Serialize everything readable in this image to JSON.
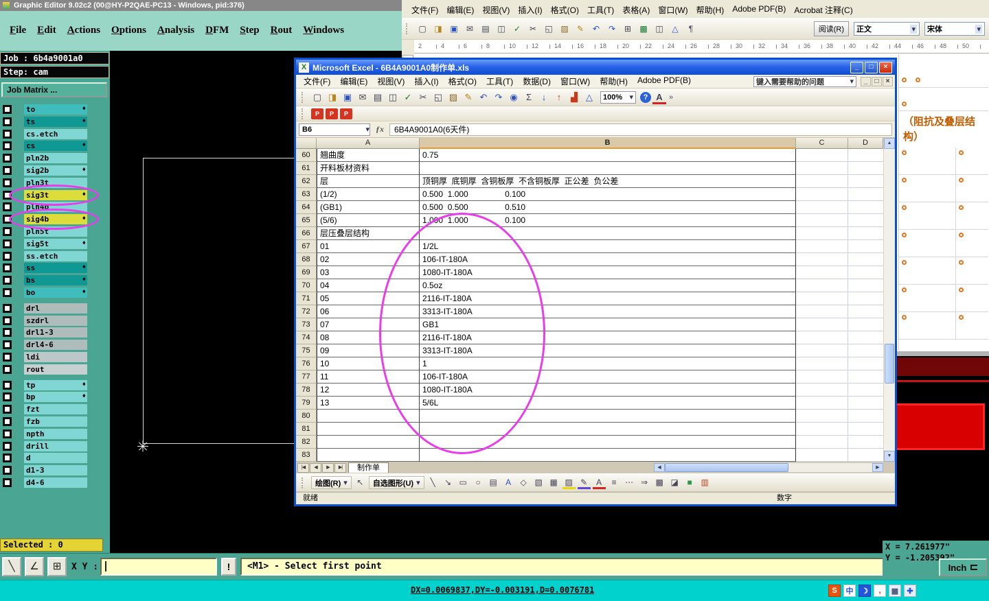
{
  "graphic_editor": {
    "title": "Graphic Editor 9.02c2 (00@HY-P2QAE-PC13 - Windows, pid:376)",
    "menus": [
      "File",
      "Edit",
      "Actions",
      "Options",
      "Analysis",
      "DFM",
      "Step",
      "Rout",
      "Windows"
    ],
    "job_label": "Job : 6b4a9001a0",
    "step_label": "Step: cam",
    "job_matrix_button": "Job Matrix ...",
    "selected_label": "Selected : 0",
    "xy_label": "X Y :",
    "xy_input_value": "",
    "alert_button": "!",
    "status_message": "<M1> - Select first point",
    "units_button": "Inch",
    "coord_x": "X = 7.261977\"",
    "coord_y": "Y = -1.205392\"",
    "accent_color": "#4aa592",
    "annotation_color": "#ea3cea",
    "toolbar_icons": [
      {
        "name": "measure-icon",
        "glyph": "╲"
      },
      {
        "name": "angle-icon",
        "glyph": "∠"
      },
      {
        "name": "grid-icon",
        "glyph": "⊞"
      }
    ],
    "layers": [
      {
        "name": "to",
        "color": "#3fbcbc",
        "marker": true
      },
      {
        "name": "ts",
        "color": "#0f9894",
        "marker": true
      },
      {
        "name": "cs.etch",
        "color": "#7fd6d2",
        "marker": false
      },
      {
        "name": "cs",
        "color": "#0f9894",
        "marker": true
      },
      {
        "name": "pln2b",
        "color": "#7fd6d2",
        "marker": false
      },
      {
        "name": "sig2b",
        "color": "#7fd6d2",
        "marker": true
      },
      {
        "name": "pln3t",
        "color": "#7fd6d2",
        "marker": false
      },
      {
        "name": "sig3t",
        "color": "#dcdc3a",
        "marker": true,
        "circled": true
      },
      {
        "name": "pln4b",
        "color": "#7fd6d2",
        "marker": false
      },
      {
        "name": "sig4b",
        "color": "#dcdc3a",
        "marker": true,
        "circled": true
      },
      {
        "name": "pln5t",
        "color": "#7fd6d2",
        "marker": false
      },
      {
        "name": "sig5t",
        "color": "#7fd6d2",
        "marker": true
      },
      {
        "name": "ss.etch",
        "color": "#7fd6d2",
        "marker": false
      },
      {
        "name": "ss",
        "color": "#0f9894",
        "marker": true
      },
      {
        "name": "bs",
        "color": "#0f9894",
        "marker": true
      },
      {
        "name": "bo",
        "color": "#3fbcbc",
        "marker": true
      },
      {
        "name": "drl",
        "color": "#aebcbc",
        "marker": false
      },
      {
        "name": "szdrl",
        "color": "#aebcbc",
        "marker": false
      },
      {
        "name": "drl1-3",
        "color": "#aebcbc",
        "marker": false
      },
      {
        "name": "drl4-6",
        "color": "#aebcbc",
        "marker": false
      },
      {
        "name": "ldi",
        "color": "#bcc8c8",
        "marker": false
      },
      {
        "name": "rout",
        "color": "#c6d0d0",
        "marker": false
      },
      {
        "name": "tp",
        "color": "#7fd6d2",
        "marker": true
      },
      {
        "name": "bp",
        "color": "#7fd6d2",
        "marker": true
      },
      {
        "name": "fzt",
        "color": "#7fd6d2",
        "marker": false
      },
      {
        "name": "fzb",
        "color": "#7fd6d2",
        "marker": false
      },
      {
        "name": "npth",
        "color": "#7fd6d2",
        "marker": false
      },
      {
        "name": "drill",
        "color": "#7fd6d2",
        "marker": false
      },
      {
        "name": "d",
        "color": "#7fd6d2",
        "marker": false
      },
      {
        "name": "d1-3",
        "color": "#7fd6d2",
        "marker": false
      },
      {
        "name": "d4-6",
        "color": "#7fd6d2",
        "marker": false
      }
    ]
  },
  "excel": {
    "title": "Microsoft Excel - 6B4A9001A0制作单.xls",
    "menus": [
      "文件(F)",
      "编辑(E)",
      "视图(V)",
      "插入(I)",
      "格式(O)",
      "工具(T)",
      "数据(D)",
      "窗口(W)",
      "帮助(H)",
      "Adobe PDF(B)"
    ],
    "help_box_placeholder": "键入需要帮助的问题",
    "zoom_value": "100%",
    "name_box": "B6",
    "fx_label": "ƒx",
    "formula_value": "6B4A9001A0(6天件)",
    "column_headers": [
      "A",
      "B",
      "C",
      "D"
    ],
    "selected_column": "B",
    "sheet_tab": "制作单",
    "status_ready": "就绪",
    "status_num": "数字",
    "draw_button": "绘图(R)",
    "autoshapes_button": "自选图形(U)",
    "toolbar_icons": [
      {
        "name": "new-document-icon",
        "glyph": "▢"
      },
      {
        "name": "open-icon",
        "glyph": "◨",
        "color": "#b8861e"
      },
      {
        "name": "save-icon",
        "glyph": "▣",
        "color": "#2a52c8"
      },
      {
        "name": "mail-icon",
        "glyph": "✉"
      },
      {
        "name": "print-icon",
        "glyph": "▤"
      },
      {
        "name": "print-preview-icon",
        "glyph": "◫"
      },
      {
        "name": "spelling-icon",
        "glyph": "✓",
        "color": "#1a7a2a"
      },
      {
        "name": "cut-icon",
        "glyph": "✂"
      },
      {
        "name": "copy-icon",
        "glyph": "◱"
      },
      {
        "name": "paste-icon",
        "glyph": "▨",
        "color": "#8a6a2a"
      },
      {
        "name": "format-painter-icon",
        "glyph": "✎",
        "color": "#b8861e"
      },
      {
        "name": "undo-icon",
        "glyph": "↶",
        "color": "#2a52c8"
      },
      {
        "name": "redo-icon",
        "glyph": "↷",
        "color": "#2a52c8"
      },
      {
        "name": "insert-hyperlink-icon",
        "glyph": "◉",
        "color": "#2a52c8"
      },
      {
        "name": "autosum-icon",
        "glyph": "Σ"
      },
      {
        "name": "sort-ascending-icon",
        "glyph": "↓",
        "color": "#2a52c8"
      },
      {
        "name": "sort-descending-icon",
        "glyph": "↑",
        "color": "#c83a1a"
      },
      {
        "name": "chart-wizard-icon",
        "glyph": "▟",
        "color": "#c83a1a"
      },
      {
        "name": "drawing-icon",
        "glyph": "△",
        "color": "#2a52c8"
      }
    ],
    "pdf_icons": [
      {
        "name": "acrobat-pdf-icon",
        "glyph": "P"
      },
      {
        "name": "acrobat-pdf-mail-icon",
        "glyph": "P"
      },
      {
        "name": "acrobat-pdf-review-icon",
        "glyph": "P"
      }
    ],
    "tab_nav_icons": [
      {
        "name": "first-sheet-icon",
        "glyph": "|◀"
      },
      {
        "name": "prev-sheet-icon",
        "glyph": "◀"
      },
      {
        "name": "next-sheet-icon",
        "glyph": "▶"
      },
      {
        "name": "last-sheet-icon",
        "glyph": "▶|"
      }
    ],
    "draw_icons": [
      {
        "name": "select-pointer-icon",
        "glyph": "↖"
      },
      {
        "name": "line-icon",
        "glyph": "╲"
      },
      {
        "name": "arrow-icon",
        "glyph": "↘"
      },
      {
        "name": "rectangle-icon",
        "glyph": "▭"
      },
      {
        "name": "oval-icon",
        "glyph": "○"
      },
      {
        "name": "textbox-icon",
        "glyph": "▤"
      },
      {
        "name": "wordart-icon",
        "glyph": "A",
        "color": "#2a52c8"
      },
      {
        "name": "diagram-icon",
        "glyph": "◇"
      },
      {
        "name": "clipart-icon",
        "glyph": "▧"
      },
      {
        "name": "picture-icon",
        "glyph": "▦"
      },
      {
        "name": "fill-color-icon",
        "glyph": "▨",
        "bar": "#e8d800"
      },
      {
        "name": "line-color-icon",
        "glyph": "✎",
        "bar": "#5a48d8"
      },
      {
        "name": "font-color-icon",
        "glyph": "A",
        "bar": "#d82222"
      },
      {
        "name": "line-style-icon",
        "glyph": "≡"
      },
      {
        "name": "dash-style-icon",
        "glyph": "⋯"
      },
      {
        "name": "arrow-style-icon",
        "glyph": "⇒"
      },
      {
        "name": "shadow-icon",
        "glyph": "▩"
      },
      {
        "name": "threed-icon",
        "glyph": "◪"
      },
      {
        "name": "green-shape-icon",
        "glyph": "■",
        "color": "#2a9a4a"
      },
      {
        "name": "chart-small-icon",
        "glyph": "▥",
        "color": "#c83a1a"
      }
    ],
    "rows": [
      {
        "n": "60",
        "a": "翘曲度",
        "b": "0.75"
      },
      {
        "n": "61",
        "a": "开料板材资料",
        "b": ""
      },
      {
        "n": "62",
        "a": "层",
        "b": "顶铜厚  底铜厚  含铜板厚  不含铜板厚  正公差  负公差"
      },
      {
        "n": "63",
        "a": "(1/2)",
        "b": "0.500  1.000                0.100"
      },
      {
        "n": "64",
        "a": "(GB1)",
        "b": "0.500  0.500                0.510"
      },
      {
        "n": "65",
        "a": "(5/6)",
        "b": "1.000  1.000                0.100"
      },
      {
        "n": "66",
        "a": "层压叠层结构",
        "b": ""
      },
      {
        "n": "67",
        "a": "01",
        "b": "1/2L"
      },
      {
        "n": "68",
        "a": "02",
        "b": "106-IT-180A"
      },
      {
        "n": "69",
        "a": "03",
        "b": "1080-IT-180A"
      },
      {
        "n": "70",
        "a": "04",
        "b": "0.5oz"
      },
      {
        "n": "71",
        "a": "05",
        "b": "2116-IT-180A"
      },
      {
        "n": "72",
        "a": "06",
        "b": "3313-IT-180A"
      },
      {
        "n": "73",
        "a": "07",
        "b": "GB1"
      },
      {
        "n": "74",
        "a": "08",
        "b": "2116-IT-180A"
      },
      {
        "n": "75",
        "a": "09",
        "b": "3313-IT-180A"
      },
      {
        "n": "76",
        "a": "10",
        "b": "1"
      },
      {
        "n": "77",
        "a": "11",
        "b": "106-IT-180A"
      },
      {
        "n": "78",
        "a": "12",
        "b": "1080-IT-180A"
      },
      {
        "n": "79",
        "a": "13",
        "b": "5/6L"
      },
      {
        "n": "80",
        "a": "",
        "b": ""
      },
      {
        "n": "81",
        "a": "",
        "b": ""
      },
      {
        "n": "82",
        "a": "",
        "b": ""
      },
      {
        "n": "83",
        "a": "",
        "b": ""
      }
    ]
  },
  "word": {
    "menus": [
      "文件(F)",
      "编辑(E)",
      "视图(V)",
      "插入(I)",
      "格式(O)",
      "工具(T)",
      "表格(A)",
      "窗口(W)",
      "帮助(H)",
      "Adobe PDF(B)",
      "Acrobat 注释(C)"
    ],
    "reading_button": "阅读(R)",
    "style_box": "正文",
    "font_box": "宋体",
    "doc_heading": [
      "（阻抗及叠层结",
      "构）"
    ],
    "doc_heading_color": "#bf5c00",
    "ruler_numbers": [
      2,
      4,
      6,
      8,
      10,
      12,
      14,
      16,
      18,
      20,
      22,
      24,
      26,
      28,
      30,
      32,
      34,
      36,
      38,
      40,
      42,
      44,
      46,
      48,
      50
    ],
    "toolbar_icons": [
      {
        "name": "new-document-icon",
        "glyph": "▢"
      },
      {
        "name": "open-icon",
        "glyph": "◨",
        "color": "#b8861e"
      },
      {
        "name": "save-icon",
        "glyph": "▣",
        "color": "#2a52c8"
      },
      {
        "name": "mail-icon",
        "glyph": "✉"
      },
      {
        "name": "print-icon",
        "glyph": "▤"
      },
      {
        "name": "print-preview-icon",
        "glyph": "◫"
      },
      {
        "name": "spelling-icon",
        "glyph": "✓",
        "color": "#1a7a2a"
      },
      {
        "name": "cut-icon",
        "glyph": "✂"
      },
      {
        "name": "copy-icon",
        "glyph": "◱"
      },
      {
        "name": "paste-icon",
        "glyph": "▨",
        "color": "#8a6a2a"
      },
      {
        "name": "format-painter-icon",
        "glyph": "✎",
        "color": "#b8861e"
      },
      {
        "name": "undo-icon",
        "glyph": "↶",
        "color": "#2a52c8"
      },
      {
        "name": "redo-icon",
        "glyph": "↷",
        "color": "#2a52c8"
      },
      {
        "name": "insert-table-icon",
        "glyph": "⊞"
      },
      {
        "name": "insert-excel-icon",
        "glyph": "▩",
        "color": "#1a7a32"
      },
      {
        "name": "columns-icon",
        "glyph": "◫"
      },
      {
        "name": "drawing-icon",
        "glyph": "△",
        "color": "#2a52c8"
      },
      {
        "name": "show-marks-icon",
        "glyph": "¶"
      }
    ]
  },
  "taskbar": {
    "delta_readout": "DX=0.0069837,DY=-0.003191,D=0.0076781",
    "tray_icons": [
      {
        "name": "sogou-logo-icon",
        "glyph": "S",
        "bg": "#e8540e",
        "fg": "#ffffff"
      },
      {
        "name": "chinese-mode-icon",
        "glyph": "中",
        "bg": "#ffffff",
        "fg": "#2255dd"
      },
      {
        "name": "halfwidth-mode-icon",
        "glyph": "☽",
        "bg": "#2255dd",
        "fg": "#ffffff"
      },
      {
        "name": "punctuation-mode-icon",
        "glyph": ",",
        "bg": "#ffffff",
        "fg": "#cc2222"
      },
      {
        "name": "soft-keyboard-icon",
        "glyph": "▦",
        "bg": "#e8eef8",
        "fg": "#445577"
      },
      {
        "name": "ime-settings-icon",
        "glyph": "✚",
        "bg": "#e8eef8",
        "fg": "#2255dd"
      }
    ]
  }
}
